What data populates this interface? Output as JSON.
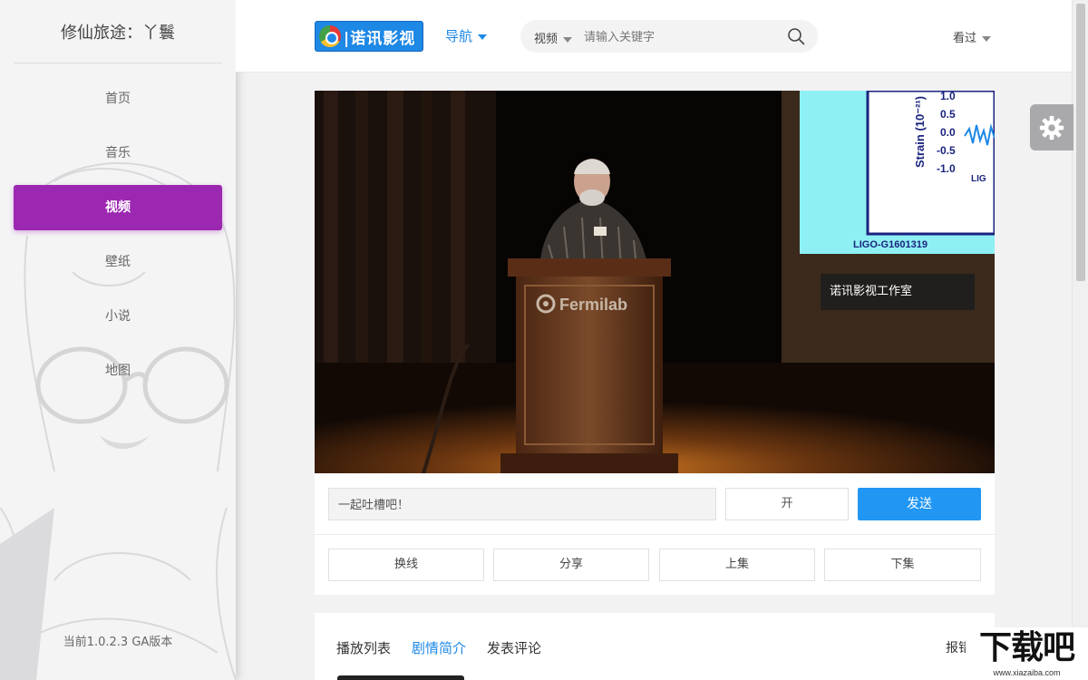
{
  "sidebar": {
    "title": "修仙旅途：丫鬟",
    "items": [
      {
        "label": "首页",
        "active": false
      },
      {
        "label": "音乐",
        "active": false
      },
      {
        "label": "视频",
        "active": true
      },
      {
        "label": "壁纸",
        "active": false
      },
      {
        "label": "小说",
        "active": false
      },
      {
        "label": "地图",
        "active": false
      }
    ],
    "version": "当前1.0.2.3 GA版本",
    "accent_color": "#9c27b0"
  },
  "header": {
    "logo_text": "|诺讯影视",
    "nav_label": "导航",
    "search": {
      "category": "视频",
      "placeholder": "请输入关键字"
    },
    "history_label": "看过"
  },
  "player": {
    "watermark": "诺讯影视工作室",
    "podium_text": "Fermilab",
    "slide_ticks": [
      "1.0",
      "0.5",
      "0.0",
      "-0.5",
      "-1.0"
    ],
    "slide_axis_label": "Strain (10⁻²¹)",
    "slide_caption": "LIGO-G1601319",
    "slide_corner": "LIG"
  },
  "danmaku": {
    "placeholder": "一起吐槽吧！",
    "toggle_label": "开",
    "send_label": "发送",
    "send_color": "#2196f3"
  },
  "episode_buttons": [
    "换线",
    "分享",
    "上集",
    "下集"
  ],
  "tabs": [
    {
      "label": "播放列表",
      "active": false
    },
    {
      "label": "剧情简介",
      "active": true
    },
    {
      "label": "发表评论",
      "active": false
    }
  ],
  "report_label": "报错",
  "corner_logo": {
    "text": "下载吧",
    "url": "www.xiazaiba.com"
  }
}
